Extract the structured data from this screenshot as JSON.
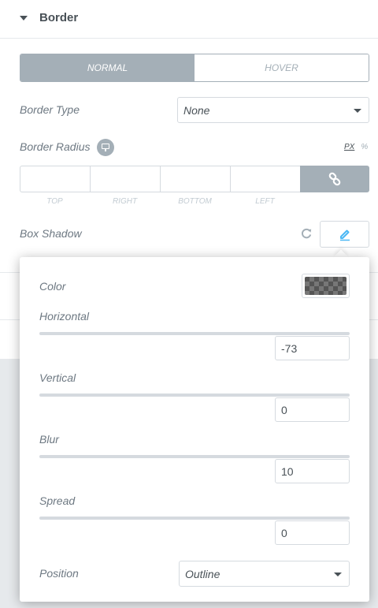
{
  "section": {
    "title": "Border"
  },
  "tabs": [
    {
      "label": "NORMAL",
      "active": true
    },
    {
      "label": "HOVER",
      "active": false
    }
  ],
  "border_type": {
    "label": "Border Type",
    "value": "None"
  },
  "border_radius": {
    "label": "Border Radius",
    "units": {
      "px": "PX",
      "percent": "%"
    },
    "dimensions": [
      "TOP",
      "RIGHT",
      "BOTTOM",
      "LEFT"
    ]
  },
  "box_shadow": {
    "label": "Box Shadow",
    "popover": {
      "color_label": "Color",
      "horizontal": {
        "label": "Horizontal",
        "value": "-73"
      },
      "vertical": {
        "label": "Vertical",
        "value": "0"
      },
      "blur": {
        "label": "Blur",
        "value": "10"
      },
      "spread": {
        "label": "Spread",
        "value": "0"
      },
      "position": {
        "label": "Position",
        "value": "Outline"
      }
    }
  },
  "colors": {
    "accent": "#a4afb7",
    "text": "#6d7882",
    "heading": "#495157",
    "edit_icon": "#4ab7f4",
    "background": "#e6e9ec"
  },
  "icons": {
    "caret": "caret-down-icon",
    "responsive": "desktop-icon",
    "link": "link-icon",
    "reset": "refresh-icon",
    "edit": "pencil-icon"
  }
}
